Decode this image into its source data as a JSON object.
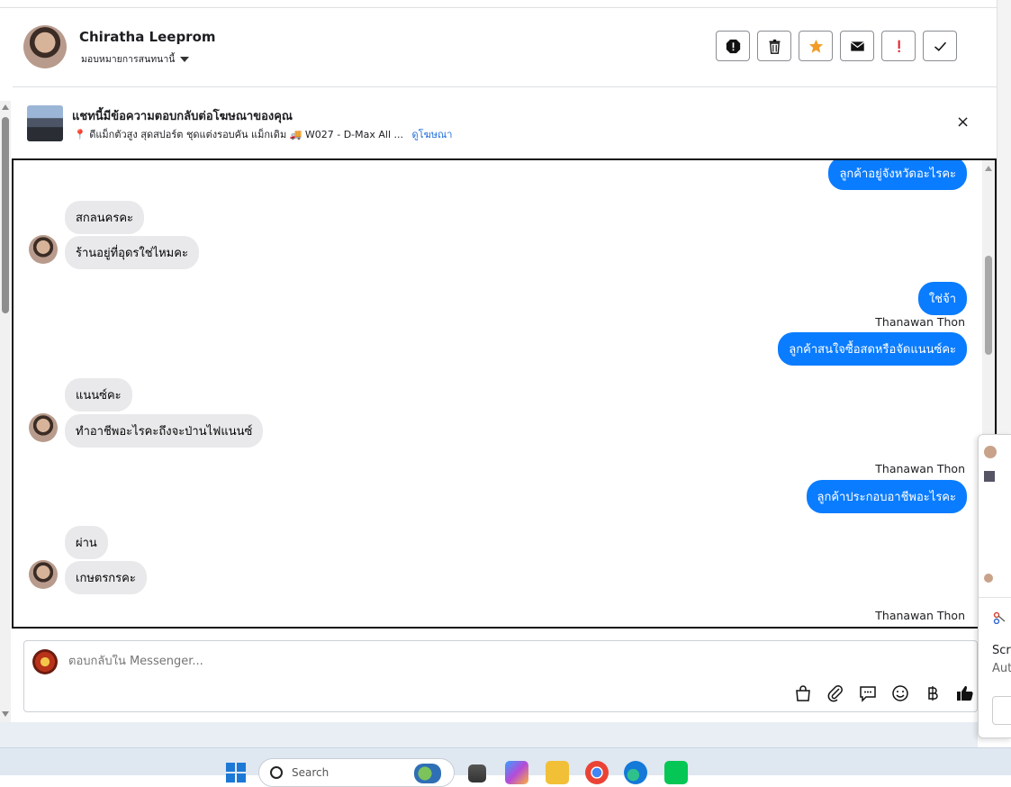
{
  "header": {
    "contact_name": "Chiratha Leeprom",
    "assign_label": "มอบหมายการสนทนานี้",
    "actions": [
      {
        "name": "report-button",
        "icon": "alert-octagon-icon"
      },
      {
        "name": "delete-button",
        "icon": "trash-icon"
      },
      {
        "name": "star-button",
        "icon": "star-icon"
      },
      {
        "name": "mark-unread-button",
        "icon": "envelope-icon"
      },
      {
        "name": "flag-important-button",
        "icon": "exclamation-icon"
      },
      {
        "name": "mark-done-button",
        "icon": "check-icon"
      }
    ]
  },
  "ad": {
    "title": "แชทนี้มีข้อความตอบกลับต่อโฆษณาของคุณ",
    "subtitle": "📍 ดีแม็กตัวสูง สุดสปอร์ต ชุดแต่งรอบคัน แม็กเดิม 🚚 W027 - D-Max All ...",
    "link": "ดูโฆษณา",
    "close": "×"
  },
  "messages": {
    "m1": "ลูกค้าอยู่จังหวัดอะไรคะ",
    "m2": "สกลนครคะ",
    "m3": "ร้านอยู่ที่อุดรใช่ไหมคะ",
    "m4": "ใช่จ้า",
    "sender1": "Thanawan Thon",
    "m5": "ลูกค้าสนใจซื้อสดหรือจัดแนนซ์คะ",
    "m6": "แนนซ์คะ",
    "m7": "ทำอาชีพอะไรคะถึงจะป่านไฟแนนซ์",
    "sender2": "Thanawan Thon",
    "m8": "ลูกค้าประกอบอาชีพอะไรคะ",
    "m9": "ผ่าน",
    "m10": "เกษตรกรคะ",
    "sender3": "Thanawan Thon"
  },
  "composer": {
    "placeholder": "ตอบกลับใน Messenger...",
    "tools": [
      "bag-icon",
      "paperclip-icon",
      "saved-reply-icon",
      "emoji-icon",
      "baht-icon",
      "thumbs-up-icon"
    ]
  },
  "popup": {
    "line1": "Scre",
    "line2": "Aut"
  },
  "taskbar": {
    "search_text": "Search"
  },
  "colors": {
    "outgoing": "#0a7cff",
    "incoming": "#e9e9eb",
    "link": "#216fdb"
  }
}
